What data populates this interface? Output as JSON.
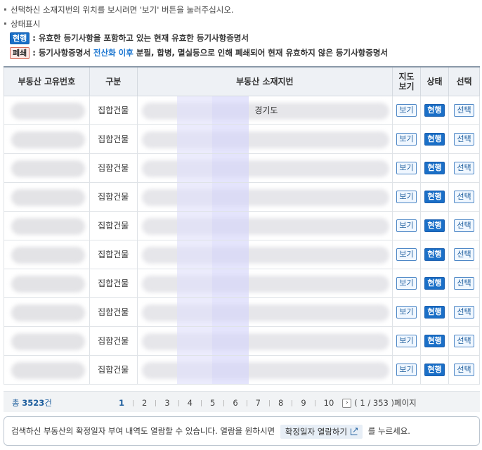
{
  "notes": {
    "line1": "선택하신 소재지번의 위치를 보시려면 '보기' 버튼을 눌러주십시오.",
    "line2": "상태표시",
    "current_badge": "현행",
    "current_desc": ": 유효한 등기사항을 포함하고 있는 현재 유효한 등기사항증명서",
    "closed_badge": "폐쇄",
    "closed_desc_pre": ": 등기사항증명서 ",
    "closed_desc_accent": "전산화 이후",
    "closed_desc_post": " 분필, 합병, 멸실등으로 인해 폐쇄되어 현재 유효하지 않은 등기사항증명서"
  },
  "table": {
    "headers": {
      "id": "부동산 고유번호",
      "type": "구분",
      "address": "부동산 소재지번",
      "map_line1": "지도",
      "map_line2": "보기",
      "status": "상태",
      "select": "선택"
    },
    "rows": [
      {
        "type": "집합건물",
        "address": "경기도",
        "view": "보기",
        "status": "현행",
        "select": "선택"
      },
      {
        "type": "집합건물",
        "address": "",
        "view": "보기",
        "status": "현행",
        "select": "선택"
      },
      {
        "type": "집합건물",
        "address": "",
        "view": "보기",
        "status": "현행",
        "select": "선택"
      },
      {
        "type": "집합건물",
        "address": "",
        "view": "보기",
        "status": "현행",
        "select": "선택"
      },
      {
        "type": "집합건물",
        "address": "",
        "view": "보기",
        "status": "현행",
        "select": "선택"
      },
      {
        "type": "집합건물",
        "address": "",
        "view": "보기",
        "status": "현행",
        "select": "선택"
      },
      {
        "type": "집합건물",
        "address": "",
        "view": "보기",
        "status": "현행",
        "select": "선택"
      },
      {
        "type": "집합건물",
        "address": "",
        "view": "보기",
        "status": "현행",
        "select": "선택"
      },
      {
        "type": "집합건물",
        "address": "",
        "view": "보기",
        "status": "현행",
        "select": "선택"
      },
      {
        "type": "집합건물",
        "address": "",
        "view": "보기",
        "status": "현행",
        "select": "선택"
      }
    ]
  },
  "pager": {
    "total_prefix": "총 ",
    "total_count": "3523",
    "total_suffix": "건",
    "pages": [
      "1",
      "2",
      "3",
      "4",
      "5",
      "6",
      "7",
      "8",
      "9",
      "10"
    ],
    "current_page": "1",
    "next_icon": "chevron-right-icon",
    "page_info": "( 1 / 353 )페이지"
  },
  "info": {
    "text_before": "검색하신 부동산의 확정일자 부여 내역도 열람할 수 있습니다. 열람을 원하시면",
    "button_label": "확정일자 열람하기",
    "text_after": "를 누르세요."
  },
  "colors": {
    "accent": "#1f78d1",
    "status_badge": "#1a6fc7",
    "header_bg": "#eef1f5"
  }
}
